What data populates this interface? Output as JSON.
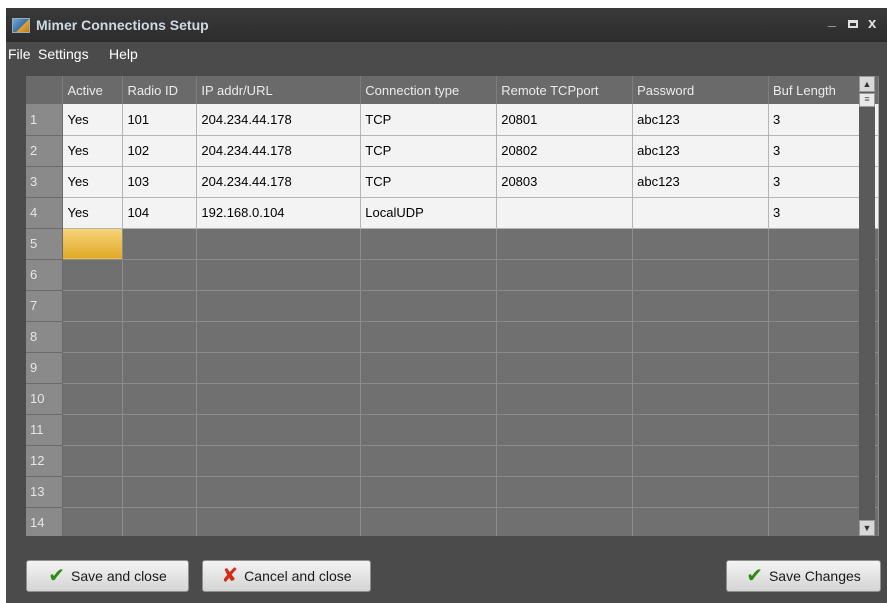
{
  "window": {
    "title": "Mimer Connections Setup",
    "icon": "app-icon",
    "controls": {
      "minimize": "_",
      "maximize": "",
      "close": "x"
    }
  },
  "menu": [
    "File",
    "Settings",
    "Help"
  ],
  "grid": {
    "columns": [
      "",
      "Active",
      "Radio ID",
      "IP addr/URL",
      "Connection type",
      "Remote TCPport",
      "Password",
      "Buf Length"
    ],
    "rows": [
      {
        "num": "1",
        "cells": [
          "Yes",
          "101",
          "204.234.44.178",
          "TCP",
          "20801",
          "abc123",
          "3"
        ]
      },
      {
        "num": "2",
        "cells": [
          "Yes",
          "102",
          "204.234.44.178",
          "TCP",
          "20802",
          "abc123",
          "3"
        ]
      },
      {
        "num": "3",
        "cells": [
          "Yes",
          "103",
          "204.234.44.178",
          "TCP",
          "20803",
          "abc123",
          "3"
        ]
      },
      {
        "num": "4",
        "cells": [
          "Yes",
          "104",
          "192.168.0.104",
          "LocalUDP",
          "",
          "",
          "3"
        ]
      },
      {
        "num": "5",
        "cells": [
          "",
          "",
          "",
          "",
          "",
          "",
          ""
        ]
      },
      {
        "num": "6",
        "cells": [
          "",
          "",
          "",
          "",
          "",
          "",
          ""
        ]
      },
      {
        "num": "7",
        "cells": [
          "",
          "",
          "",
          "",
          "",
          "",
          ""
        ]
      },
      {
        "num": "8",
        "cells": [
          "",
          "",
          "",
          "",
          "",
          "",
          ""
        ]
      },
      {
        "num": "9",
        "cells": [
          "",
          "",
          "",
          "",
          "",
          "",
          ""
        ]
      },
      {
        "num": "10",
        "cells": [
          "",
          "",
          "",
          "",
          "",
          "",
          ""
        ]
      },
      {
        "num": "11",
        "cells": [
          "",
          "",
          "",
          "",
          "",
          "",
          ""
        ]
      },
      {
        "num": "12",
        "cells": [
          "",
          "",
          "",
          "",
          "",
          "",
          ""
        ]
      },
      {
        "num": "13",
        "cells": [
          "",
          "",
          "",
          "",
          "",
          "",
          ""
        ]
      },
      {
        "num": "14",
        "cells": [
          "",
          "",
          "",
          "",
          "",
          "",
          ""
        ]
      }
    ],
    "filled_row_count": 4,
    "selected_cell": {
      "row": "5",
      "column": "Active"
    }
  },
  "scrollbar": {
    "up_icon": "scroll-up-arrow-icon",
    "down_icon": "scroll-down-arrow-icon"
  },
  "buttons": {
    "save_close": "Save and close",
    "cancel_close": "Cancel and close",
    "save_changes": "Save Changes"
  },
  "colors": {
    "title_text": "#cfd8e3",
    "selection": "#e8b83a",
    "check": "#2e8b12",
    "cancel_x": "#d42a18"
  }
}
